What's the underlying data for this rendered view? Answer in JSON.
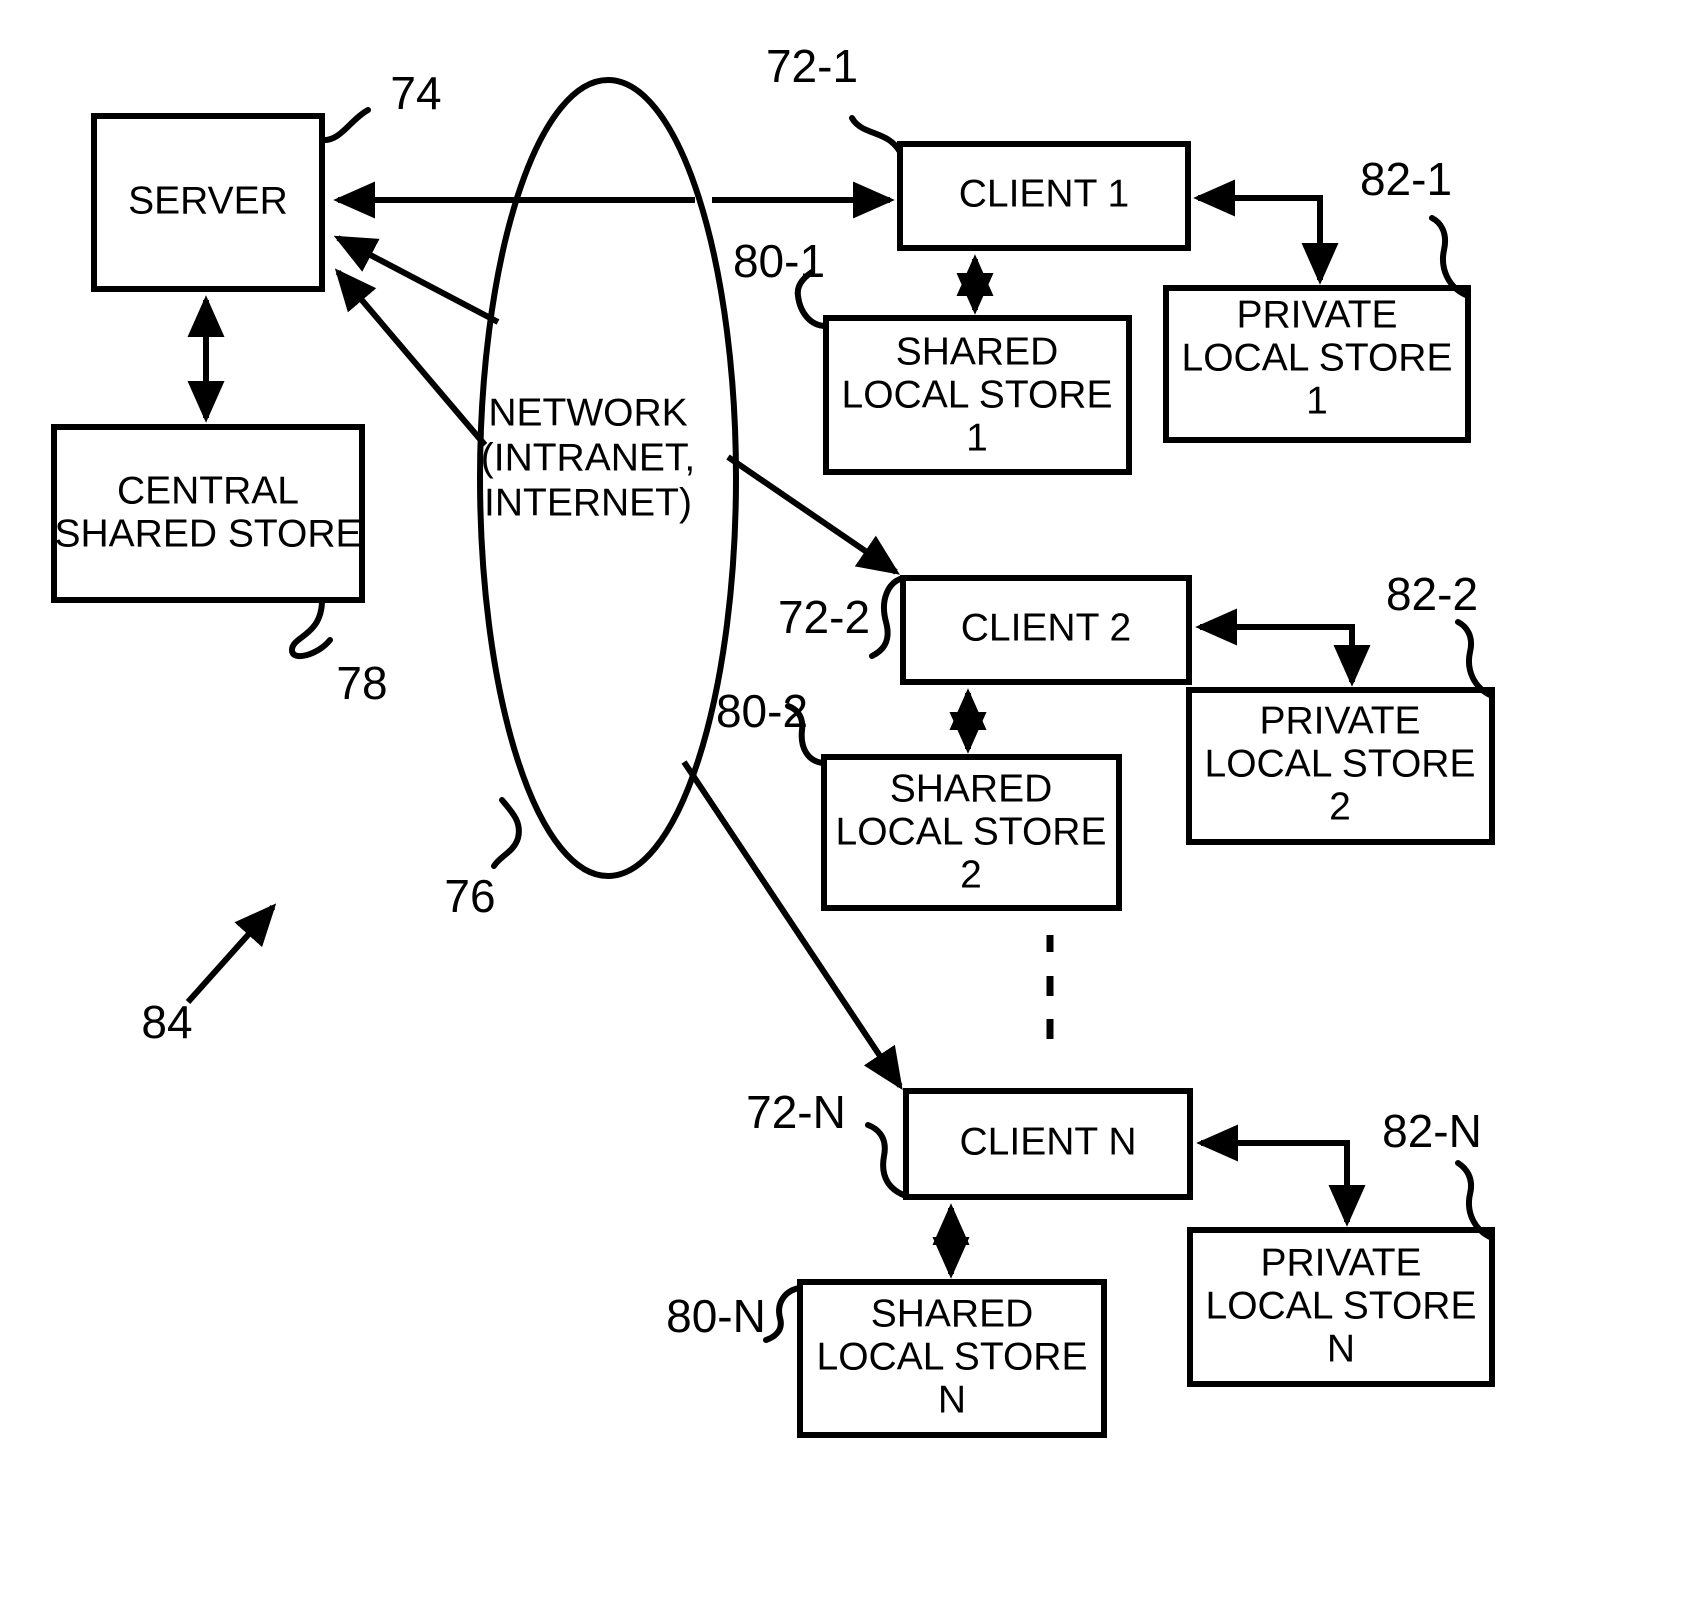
{
  "figure": {
    "type": "patent-block-diagram",
    "overall_ref": "84"
  },
  "nodes": {
    "server": {
      "label": "SERVER",
      "ref": "74"
    },
    "central_shared_store": {
      "line1": "CENTRAL",
      "line2": "SHARED STORE",
      "ref": "78"
    },
    "network": {
      "line1": "NETWORK",
      "line2": "(INTRANET,",
      "line3": "INTERNET)",
      "ref": "76"
    },
    "client1": {
      "label": "CLIENT 1",
      "ref": "72-1"
    },
    "client2": {
      "label": "CLIENT 2",
      "ref": "72-2"
    },
    "clientN": {
      "label": "CLIENT N",
      "ref": "72-N"
    },
    "shared_local_store_1": {
      "line1": "SHARED",
      "line2": "LOCAL STORE",
      "line3": "1",
      "ref": "80-1"
    },
    "shared_local_store_2": {
      "line1": "SHARED",
      "line2": "LOCAL STORE",
      "line3": "2",
      "ref": "80-2"
    },
    "shared_local_store_N": {
      "line1": "SHARED",
      "line2": "LOCAL STORE",
      "line3": "N",
      "ref": "80-N"
    },
    "private_local_store_1": {
      "line1": "PRIVATE",
      "line2": "LOCAL STORE",
      "line3": "1",
      "ref": "82-1"
    },
    "private_local_store_2": {
      "line1": "PRIVATE",
      "line2": "LOCAL STORE",
      "line3": "2",
      "ref": "82-2"
    },
    "private_local_store_N": {
      "line1": "PRIVATE",
      "line2": "LOCAL STORE",
      "line3": "N",
      "ref": "82-N"
    }
  },
  "colors": {
    "stroke": "#000000",
    "background": "#ffffff"
  }
}
